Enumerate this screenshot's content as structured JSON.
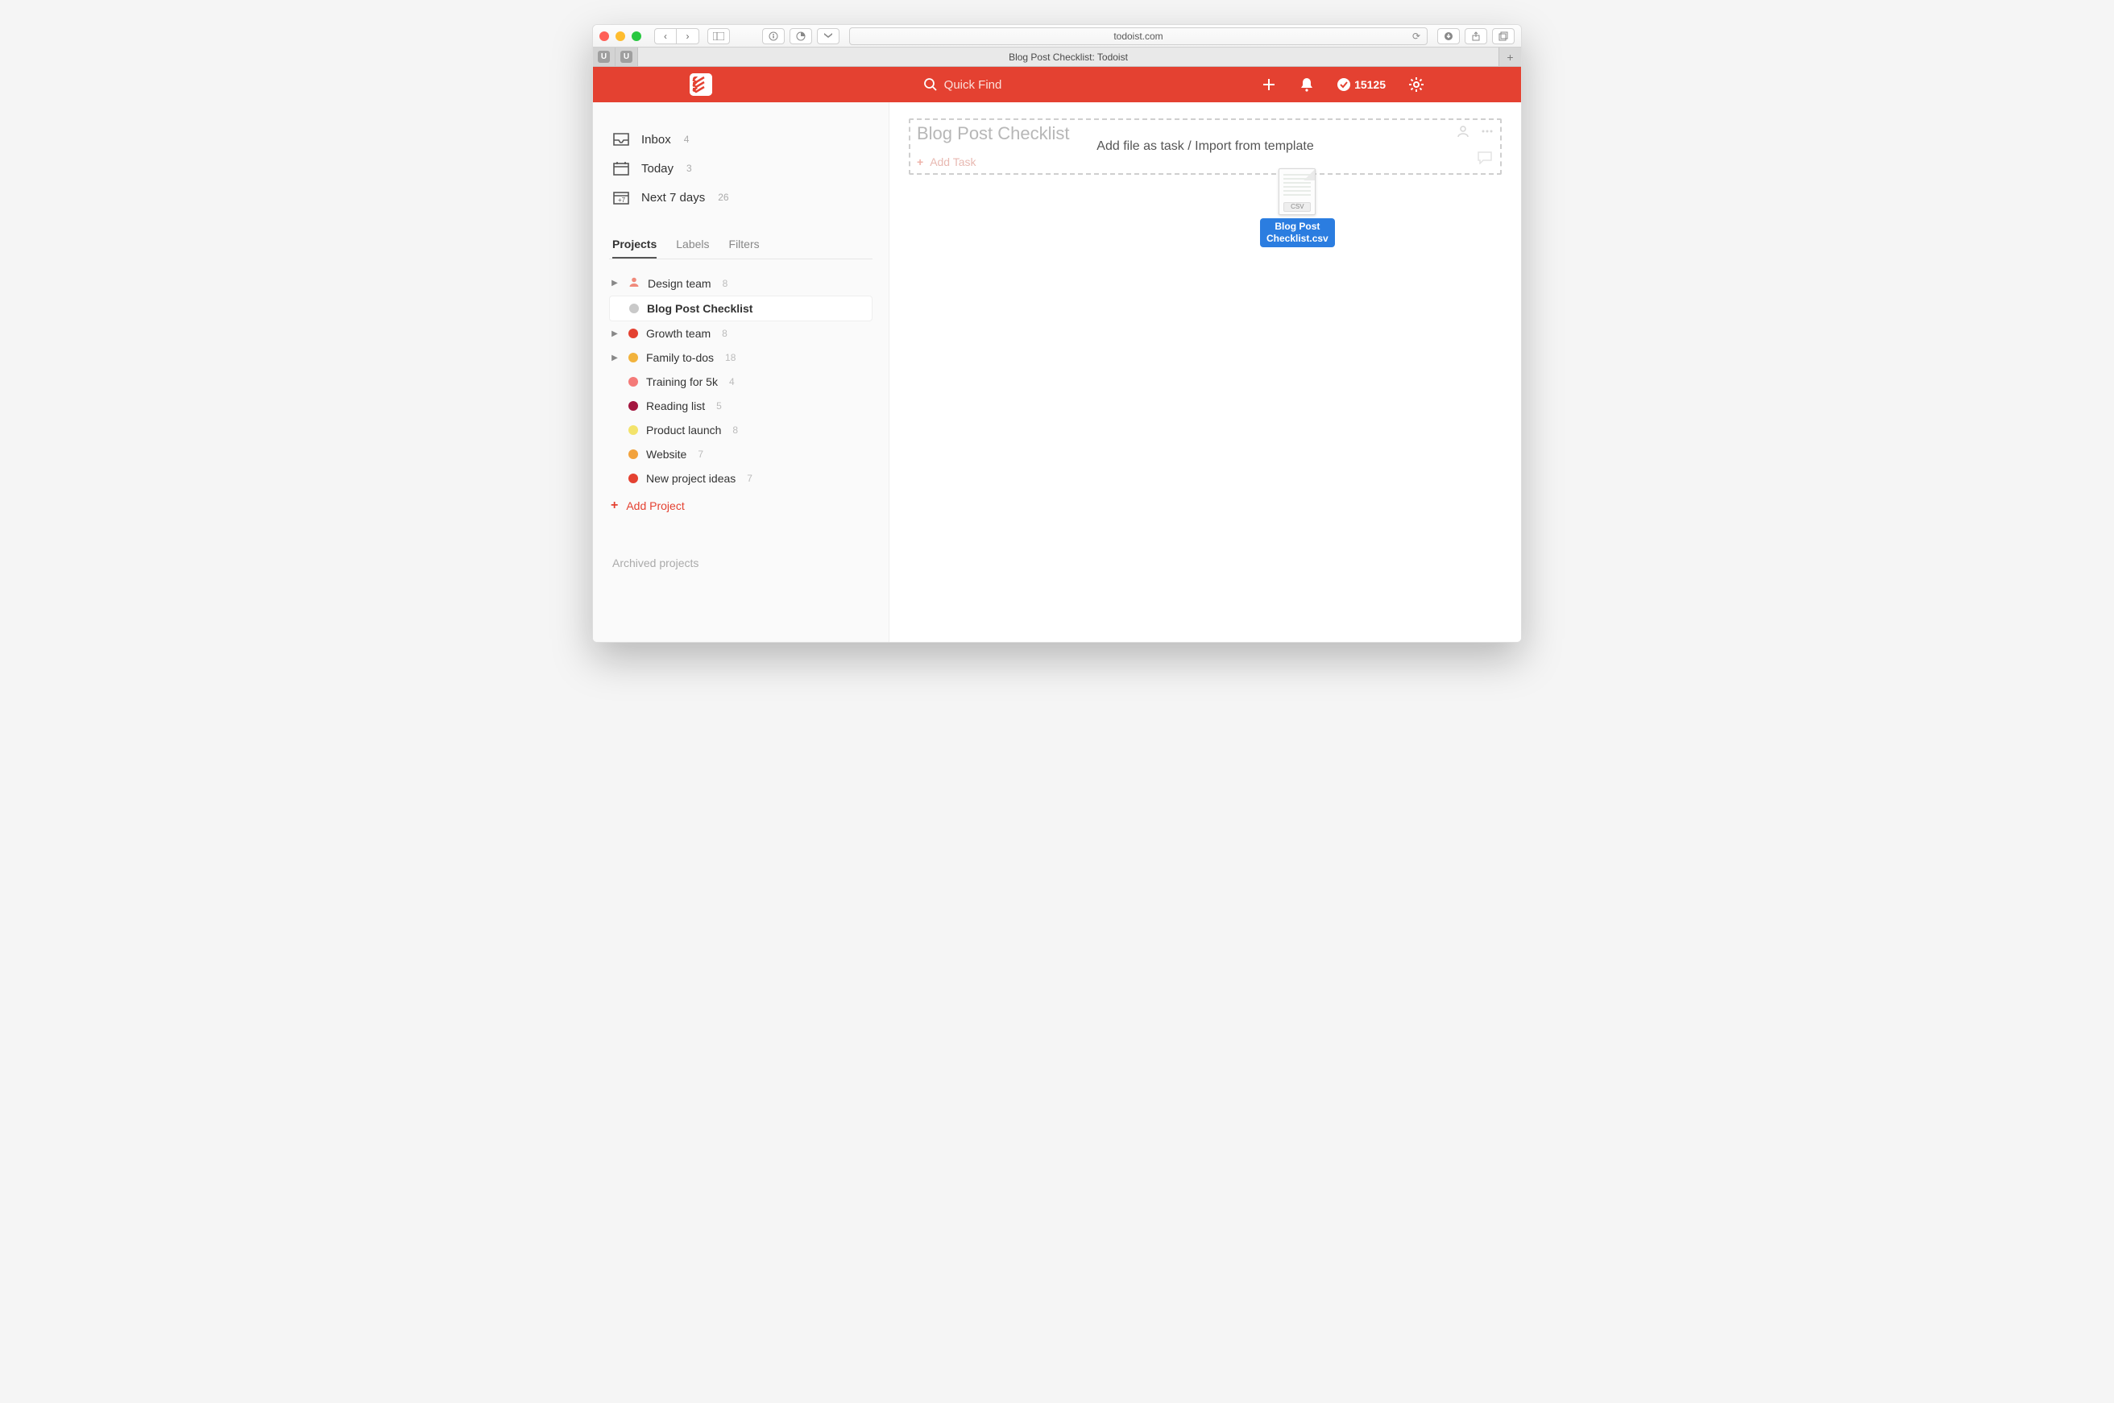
{
  "browser": {
    "url_display": "todoist.com",
    "tab_title": "Blog Post Checklist: Todoist",
    "pinned_label": "U"
  },
  "header": {
    "search_placeholder": "Quick Find",
    "karma_points": "15125"
  },
  "sidebar": {
    "inbox": {
      "label": "Inbox",
      "count": "4"
    },
    "today": {
      "label": "Today",
      "count": "3"
    },
    "next7": {
      "label": "Next 7 days",
      "count": "26"
    },
    "tabs": {
      "projects": "Projects",
      "labels": "Labels",
      "filters": "Filters"
    },
    "projects": [
      {
        "name": "Design team",
        "count": "8",
        "color": "#f08a7b",
        "expandable": true,
        "icon": "person"
      },
      {
        "name": "Blog Post Checklist",
        "count": "",
        "color": "#c9c9c9",
        "selected": true
      },
      {
        "name": "Growth team",
        "count": "8",
        "color": "#e44131",
        "expandable": true
      },
      {
        "name": "Family to-dos",
        "count": "18",
        "color": "#f2b33d",
        "expandable": true
      },
      {
        "name": "Training for 5k",
        "count": "4",
        "color": "#f47a78"
      },
      {
        "name": "Reading list",
        "count": "5",
        "color": "#a3163f"
      },
      {
        "name": "Product launch",
        "count": "8",
        "color": "#f3e36b"
      },
      {
        "name": "Website",
        "count": "7",
        "color": "#f2a23d"
      },
      {
        "name": "New project ideas",
        "count": "7",
        "color": "#e44131"
      }
    ],
    "add_project": "Add Project",
    "archived": "Archived projects"
  },
  "main": {
    "project_title": "Blog Post Checklist",
    "dropzone_text": "Add file as task / Import from template",
    "add_task": "Add Task",
    "dragged_file": {
      "ext": "CSV",
      "name_line1": "Blog Post",
      "name_line2": "Checklist.csv"
    }
  }
}
